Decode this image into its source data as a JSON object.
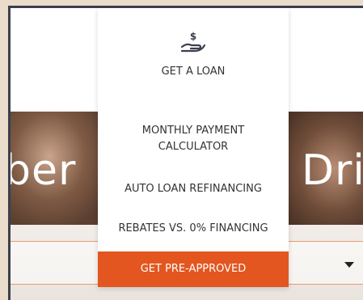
{
  "menu": {
    "icon": "money-hand-icon",
    "heading": "GET A LOAN",
    "items": [
      {
        "label": "MONTHLY PAYMENT\nCALCULATOR"
      },
      {
        "label": "AUTO LOAN REFINANCING"
      },
      {
        "label": "REBATES VS. 0% FINANCING"
      }
    ],
    "cta_label": "GET PRE-APPROVED"
  },
  "hero": {
    "title_left": "ber",
    "title_right": "Dri"
  },
  "colors": {
    "accent": "#e3561f",
    "frame": "#3b3f4d",
    "field_border": "#e89a6c"
  }
}
